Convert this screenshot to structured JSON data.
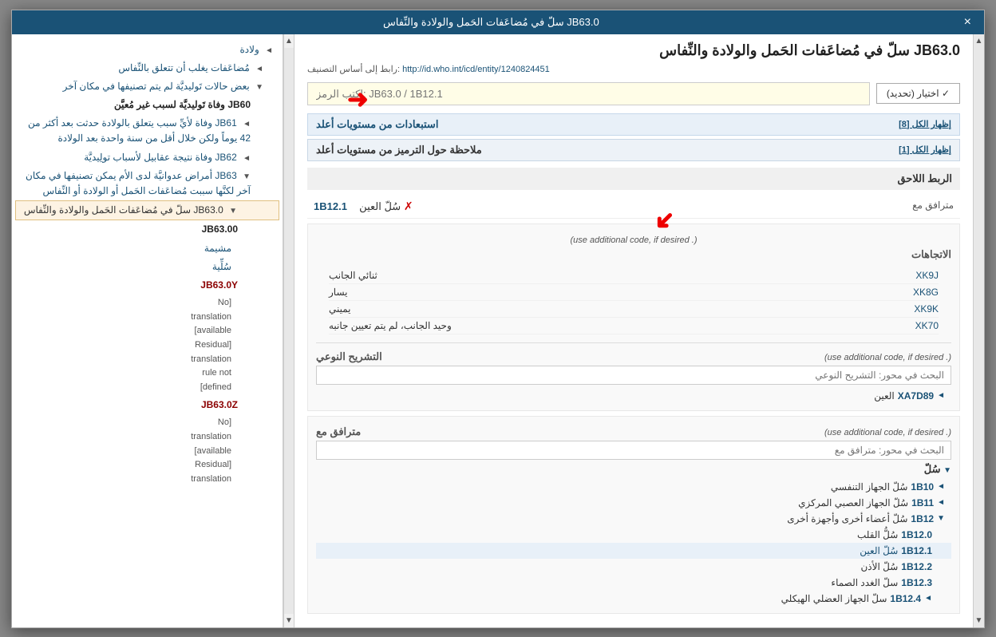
{
  "modal": {
    "header_title": "JB63.0 سلّ في مُضاعَفات الحَمل والولادة والنِّفاس",
    "close_label": "×"
  },
  "sidebar": {
    "items": [
      {
        "id": "item-birth",
        "label": "ولادة",
        "indent": 0,
        "type": "blue",
        "arrow": "◄"
      },
      {
        "id": "item-complications",
        "label": "مُضاعَفات يغلب أن تتعلق بالنِّفاس",
        "indent": 1,
        "type": "blue",
        "arrow": "◄"
      },
      {
        "id": "item-unclassified",
        "label": "بعض حالات تَوليديَّة لم يتم تصنيفها في مكان آخر",
        "indent": 1,
        "type": "blue",
        "arrow": "▼"
      },
      {
        "id": "item-jb60",
        "label": "JB60 وفاة تَوليديَّة لسبب غير مُعيَّن",
        "indent": 2,
        "type": "dark-bold",
        "arrow": ""
      },
      {
        "id": "item-jb61",
        "label": "JB61 وفاة لأيِّ سبب يتعلق بالولادة حدثت بعد أكثر من 42 يوماً ولكن خلال أقل من سنة واحدة بعد الولادة",
        "indent": 2,
        "type": "blue",
        "arrow": "◄"
      },
      {
        "id": "item-jb62",
        "label": "JB62 وفاة نتيجة عقابيل لأسباب تولِيديَّة",
        "indent": 2,
        "type": "blue",
        "arrow": "◄"
      },
      {
        "id": "item-jb63",
        "label": "JB63 أمراض عدوانيَّة لدى الأم يمكن تصنيفها في مكان آخر لكنَّها سببت مُضاعَفات الحَمل أو الولادة أو النِّفاس",
        "indent": 2,
        "type": "blue",
        "arrow": "▼"
      },
      {
        "id": "item-jb630-label",
        "label": "JB63.0 سلّ في مُضاعَفات الحَمل والولادة والنِّفاس",
        "indent": 3,
        "type": "highlighted",
        "arrow": "▼"
      },
      {
        "id": "item-jb6300",
        "label": "JB63.00",
        "indent": 3,
        "type": "dark-bold",
        "arrow": ""
      },
      {
        "id": "item-jb6300a",
        "label": "مشيمة",
        "indent": 4,
        "type": "blue",
        "arrow": ""
      },
      {
        "id": "item-jb6300b",
        "label": "سُلِّية",
        "indent": 4,
        "type": "blue",
        "arrow": ""
      },
      {
        "id": "item-jb630y",
        "label": "JB63.0Y",
        "indent": 3,
        "type": "red-bold",
        "arrow": ""
      },
      {
        "id": "item-jb630y-notrans",
        "label": "[No translation available] [Residual translation rule not defined]",
        "indent": 4,
        "type": "no-translation",
        "arrow": ""
      },
      {
        "id": "item-jb630z",
        "label": "JB63.0Z",
        "indent": 3,
        "type": "red-bold",
        "arrow": ""
      },
      {
        "id": "item-jb630z-notrans",
        "label": "[No translation available] [Residual translation",
        "indent": 4,
        "type": "no-translation",
        "arrow": ""
      }
    ]
  },
  "main": {
    "title": "JB63.0 سلّ في مُضاعَفات الحَمل والولادة والنِّفاس",
    "link_label": "رابط إلى أساس التصنيف:",
    "link_url": "http://id.who.int/icd/entity/1240824451",
    "code_input_placeholder": "اكتب الرمز: JB63.0 / 1B12.1",
    "choose_btn_label": "✓ اختيار (تحديد)",
    "section1_label": "استبعادات من مستويات أعلد",
    "section1_show": "إظهار الكل [8]",
    "section2_label": "ملاحظة حول الترميز من مستويات أعلد",
    "section2_show": "إظهار الكل [1]",
    "related_link_label": "الربط اللاحق",
    "companion_label": "مترافق مع",
    "linked_item": {
      "code": "1B12.1",
      "name": "سُلّ العين",
      "xmark": "✗"
    },
    "additional_code_label": "(. use additional code, if desired)",
    "directions_label": "الاتجاهات",
    "direction_items": [
      {
        "code": "XK9J",
        "name": "ثنائي الجانب"
      },
      {
        "code": "XK8G",
        "name": "يسار"
      },
      {
        "code": "XK9K",
        "name": "يميني"
      },
      {
        "code": "XK70",
        "name": "وحيد الجانب، لم يتم تعيين جانبه"
      }
    ],
    "topography_label": "التشريح النوعي",
    "topography_additional_label": "(. use additional code, if desired)",
    "topography_search_placeholder": "البحث في محور: التشريح النوعي",
    "topography_item": {
      "code": "XA7D89",
      "name": "العين",
      "arrow": "◄"
    },
    "companion2_label": "مترافق مع",
    "companion2_additional_label": "(. use additional code, if desired)",
    "companion2_search_placeholder": "البحث في محور: مترافق مع",
    "sull_label": "سُلّ",
    "tree_items": [
      {
        "code": "1B10",
        "name": "سُلّ الجهاز التنفسي",
        "arrow": "◄",
        "indent": 0
      },
      {
        "code": "1B11",
        "name": "سُلّ الجهاز العصبي المركزي",
        "arrow": "◄",
        "indent": 0
      },
      {
        "code": "1B12",
        "name": "سُلّ أعضاء أخرى وأجهزة أخرى",
        "arrow": "▼",
        "indent": 0
      },
      {
        "code": "1B12.0",
        "name": "سُلُّ القلب",
        "arrow": "",
        "indent": 1
      },
      {
        "code": "1B12.1",
        "name": "سُلّ العين",
        "arrow": "",
        "indent": 1,
        "active": true
      },
      {
        "code": "1B12.2",
        "name": "سُلّ الأذن",
        "arrow": "",
        "indent": 1
      },
      {
        "code": "1B12.3",
        "name": "سلّ الغدد الصماء",
        "arrow": "",
        "indent": 1
      },
      {
        "code": "1B12.4",
        "name": "سلّ الجهاز العضلي الهيكلي",
        "arrow": "◄",
        "indent": 1
      }
    ]
  }
}
